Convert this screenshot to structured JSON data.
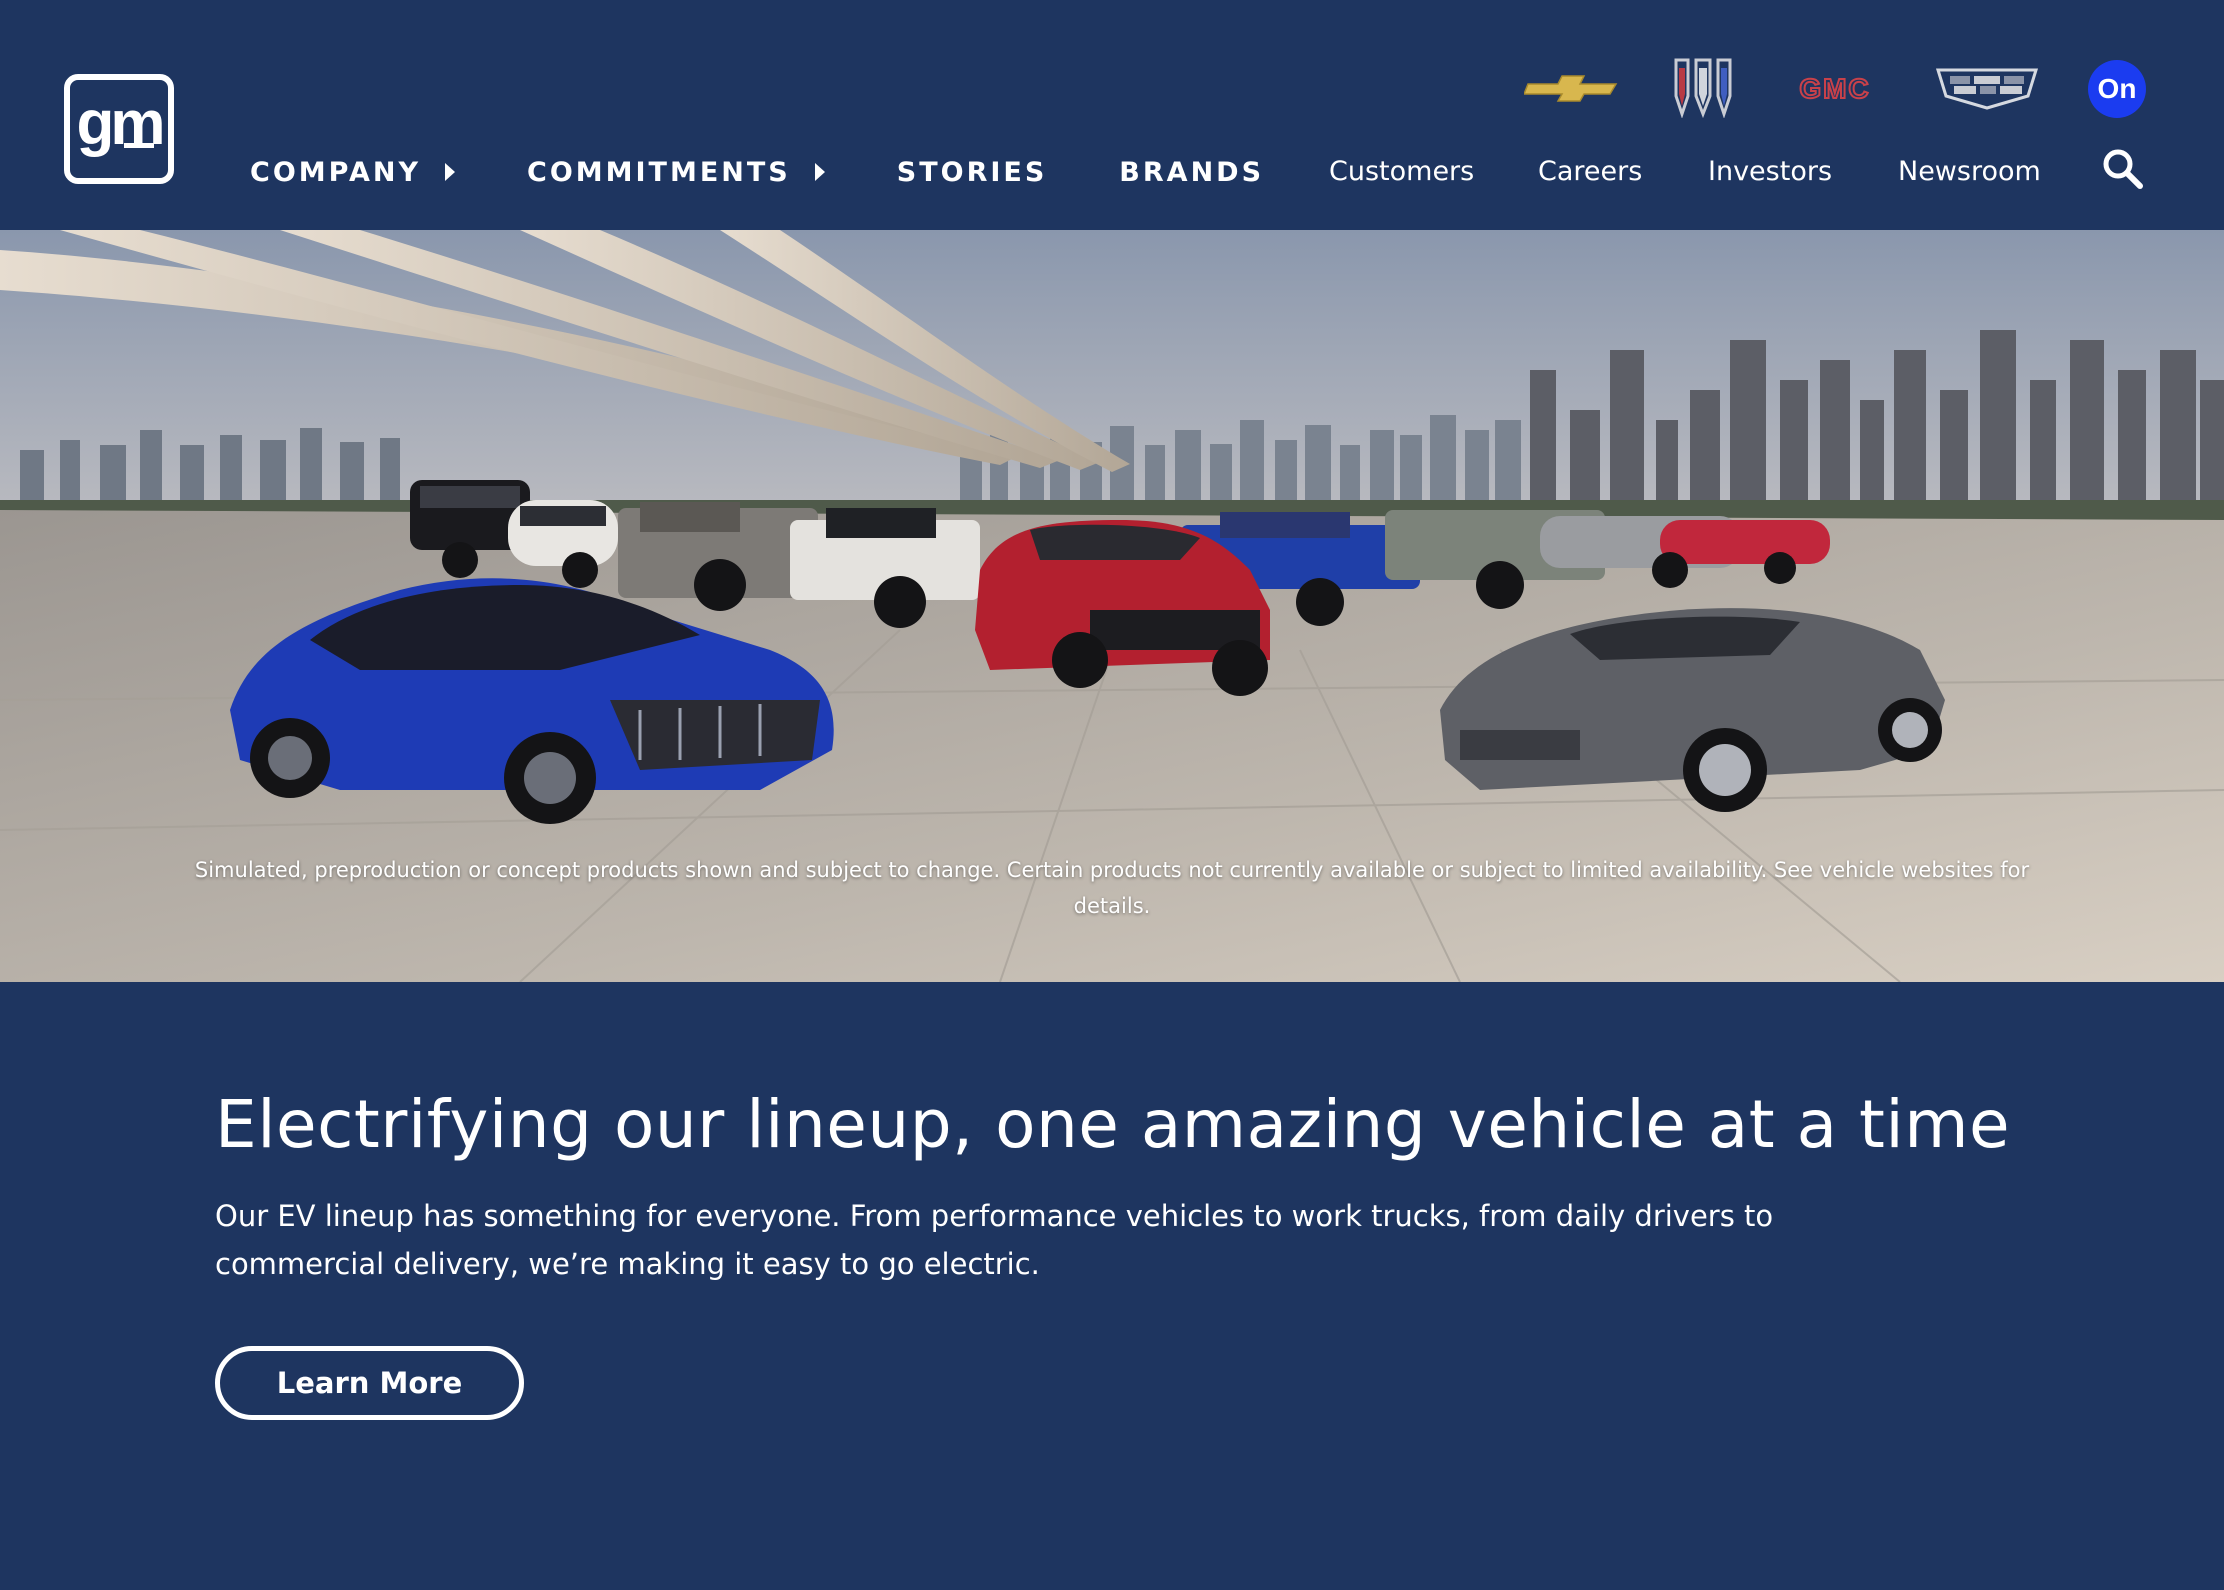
{
  "header": {
    "logo_text": "gm",
    "nav_main": [
      {
        "label": "COMPANY",
        "has_submenu": true
      },
      {
        "label": "COMMITMENTS",
        "has_submenu": true
      },
      {
        "label": "STORIES",
        "has_submenu": false
      },
      {
        "label": "BRANDS",
        "has_submenu": false
      }
    ],
    "nav_secondary": [
      {
        "label": "Customers"
      },
      {
        "label": "Careers"
      },
      {
        "label": "Investors"
      },
      {
        "label": "Newsroom"
      }
    ],
    "brands": [
      {
        "name": "chevrolet-logo"
      },
      {
        "name": "buick-logo"
      },
      {
        "name": "gmc-logo",
        "text": "GMC"
      },
      {
        "name": "cadillac-logo"
      },
      {
        "name": "onstar-logo",
        "text": "On"
      }
    ],
    "search_icon": "search-icon"
  },
  "hero": {
    "disclaimer": "Simulated, preproduction or concept products shown and subject to change. Certain products not currently available or subject to limited availability. See vehicle websites for details."
  },
  "content": {
    "headline": "Electrifying our lineup, one amazing vehicle at a time",
    "body": "Our EV lineup has something for everyone. From performance vehicles to work trucks, from daily drivers to commercial delivery, we’re making it easy to go electric.",
    "cta_label": "Learn More"
  },
  "colors": {
    "background": "#1e3560",
    "text": "#ffffff",
    "onstar_blue": "#1b3cf0",
    "gmc_red": "#c8414a",
    "chevy_gold": "#d8b74e"
  }
}
